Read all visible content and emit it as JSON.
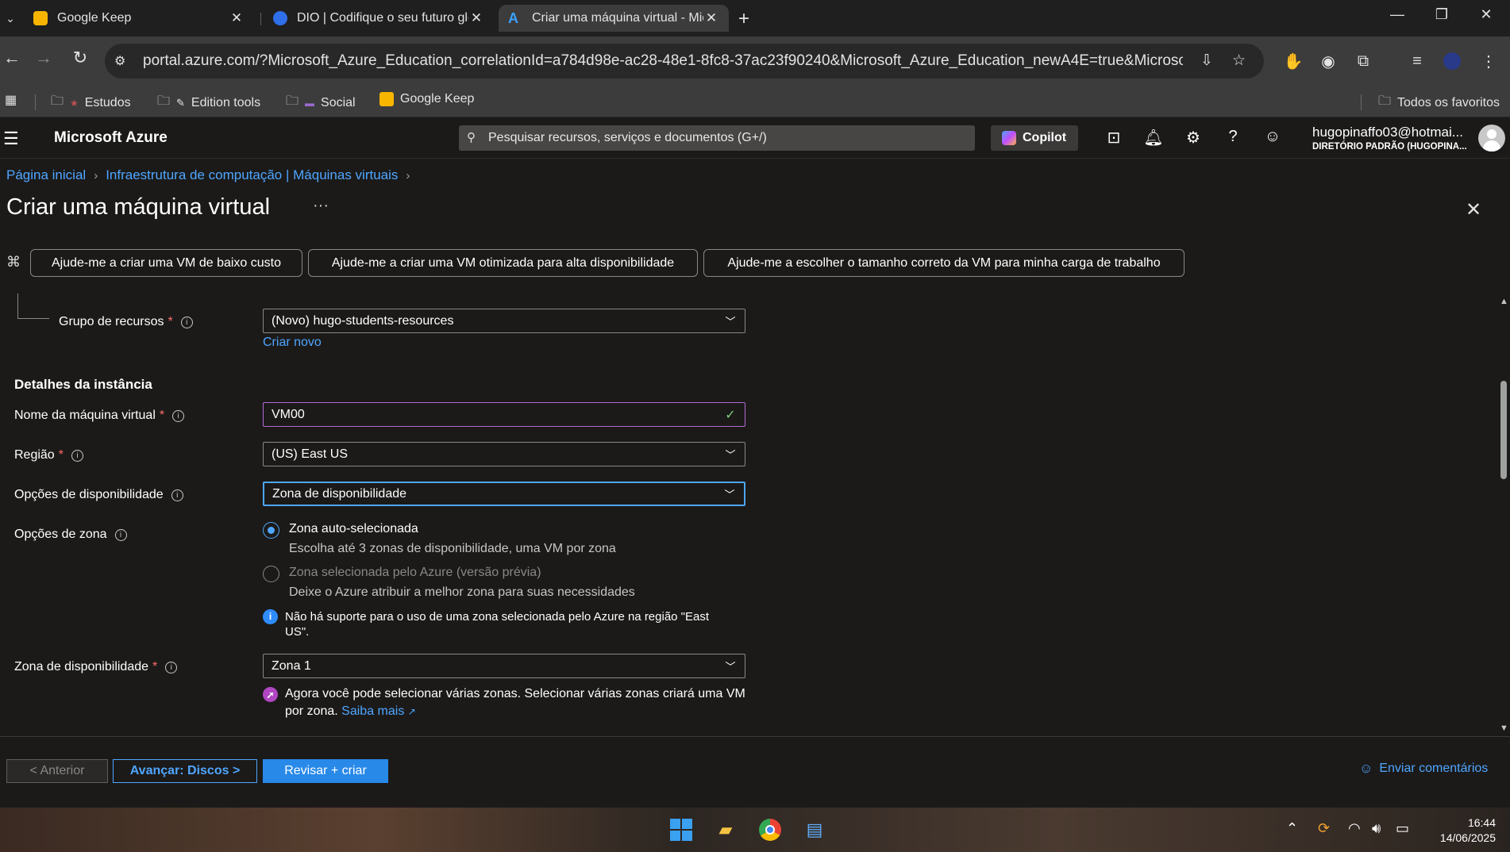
{
  "browser": {
    "tabs": [
      {
        "title": "Google Keep"
      },
      {
        "title": "DIO | Codifique o seu futuro glo"
      },
      {
        "title": "Criar uma máquina virtual - Micr"
      }
    ],
    "url": "portal.azure.com/?Microsoft_Azure_Education_correlationId=a784d98e-ac28-48e1-8fc8-37ac23f90240&Microsoft_Azure_Education_newA4E=true&Microsoft_Azure_Educ...",
    "bookmarks": [
      {
        "label": "Estudos"
      },
      {
        "label": "Edition tools"
      },
      {
        "label": "Social"
      },
      {
        "label": "Google Keep"
      }
    ],
    "all_bookmarks": "Todos os favoritos"
  },
  "azure": {
    "brand": "Microsoft Azure",
    "search_placeholder": "Pesquisar recursos, serviços e documentos (G+/)",
    "copilot": "Copilot",
    "account_name": "hugopinaffo03@hotmai...",
    "account_dir": "DIRETÓRIO PADRÃO (HUGOPINA..."
  },
  "breadcrumb": {
    "home": "Página inicial",
    "parent": "Infraestrutura de computação | Máquinas virtuais"
  },
  "page": {
    "title": "Criar uma máquina virtual",
    "more": "···"
  },
  "suggestions": [
    "Ajude-me a criar uma VM de baixo custo",
    "Ajude-me a criar uma VM otimizada para alta disponibilidade",
    "Ajude-me a escolher o tamanho correto da VM para minha carga de trabalho"
  ],
  "form": {
    "resource_group": {
      "label": "Grupo de recursos",
      "value": "(Novo) hugo-students-resources",
      "create_new": "Criar novo"
    },
    "instance_section": "Detalhes da instância",
    "vm_name": {
      "label": "Nome da máquina virtual",
      "value": "VM00"
    },
    "region": {
      "label": "Região",
      "value": "(US) East US"
    },
    "availability_options": {
      "label": "Opções de disponibilidade",
      "value": "Zona de disponibilidade"
    },
    "zone_options": {
      "label": "Opções de zona",
      "auto": {
        "title": "Zona auto-selecionada",
        "desc": "Escolha até 3 zonas de disponibilidade, uma VM por zona"
      },
      "azure": {
        "title": "Zona selecionada pelo Azure (versão prévia)",
        "desc": "Deixe o Azure atribuir a melhor zona para suas necessidades"
      },
      "notice_line1": "Não há suporte para o uso de uma zona selecionada pelo Azure na região \"East",
      "notice_line2": "US\"."
    },
    "availability_zone": {
      "label": "Zona de disponibilidade",
      "value": "Zona 1",
      "notice_line1": "Agora você pode selecionar várias zonas. Selecionar várias zonas criará uma VM",
      "notice_line2": "por zona.",
      "learn_more": "Saiba mais"
    }
  },
  "footer": {
    "prev": "< Anterior",
    "next": "Avançar: Discos >",
    "review": "Revisar + criar",
    "feedback": "Enviar comentários"
  },
  "taskbar": {
    "time": "16:44",
    "date": "14/06/2025"
  }
}
